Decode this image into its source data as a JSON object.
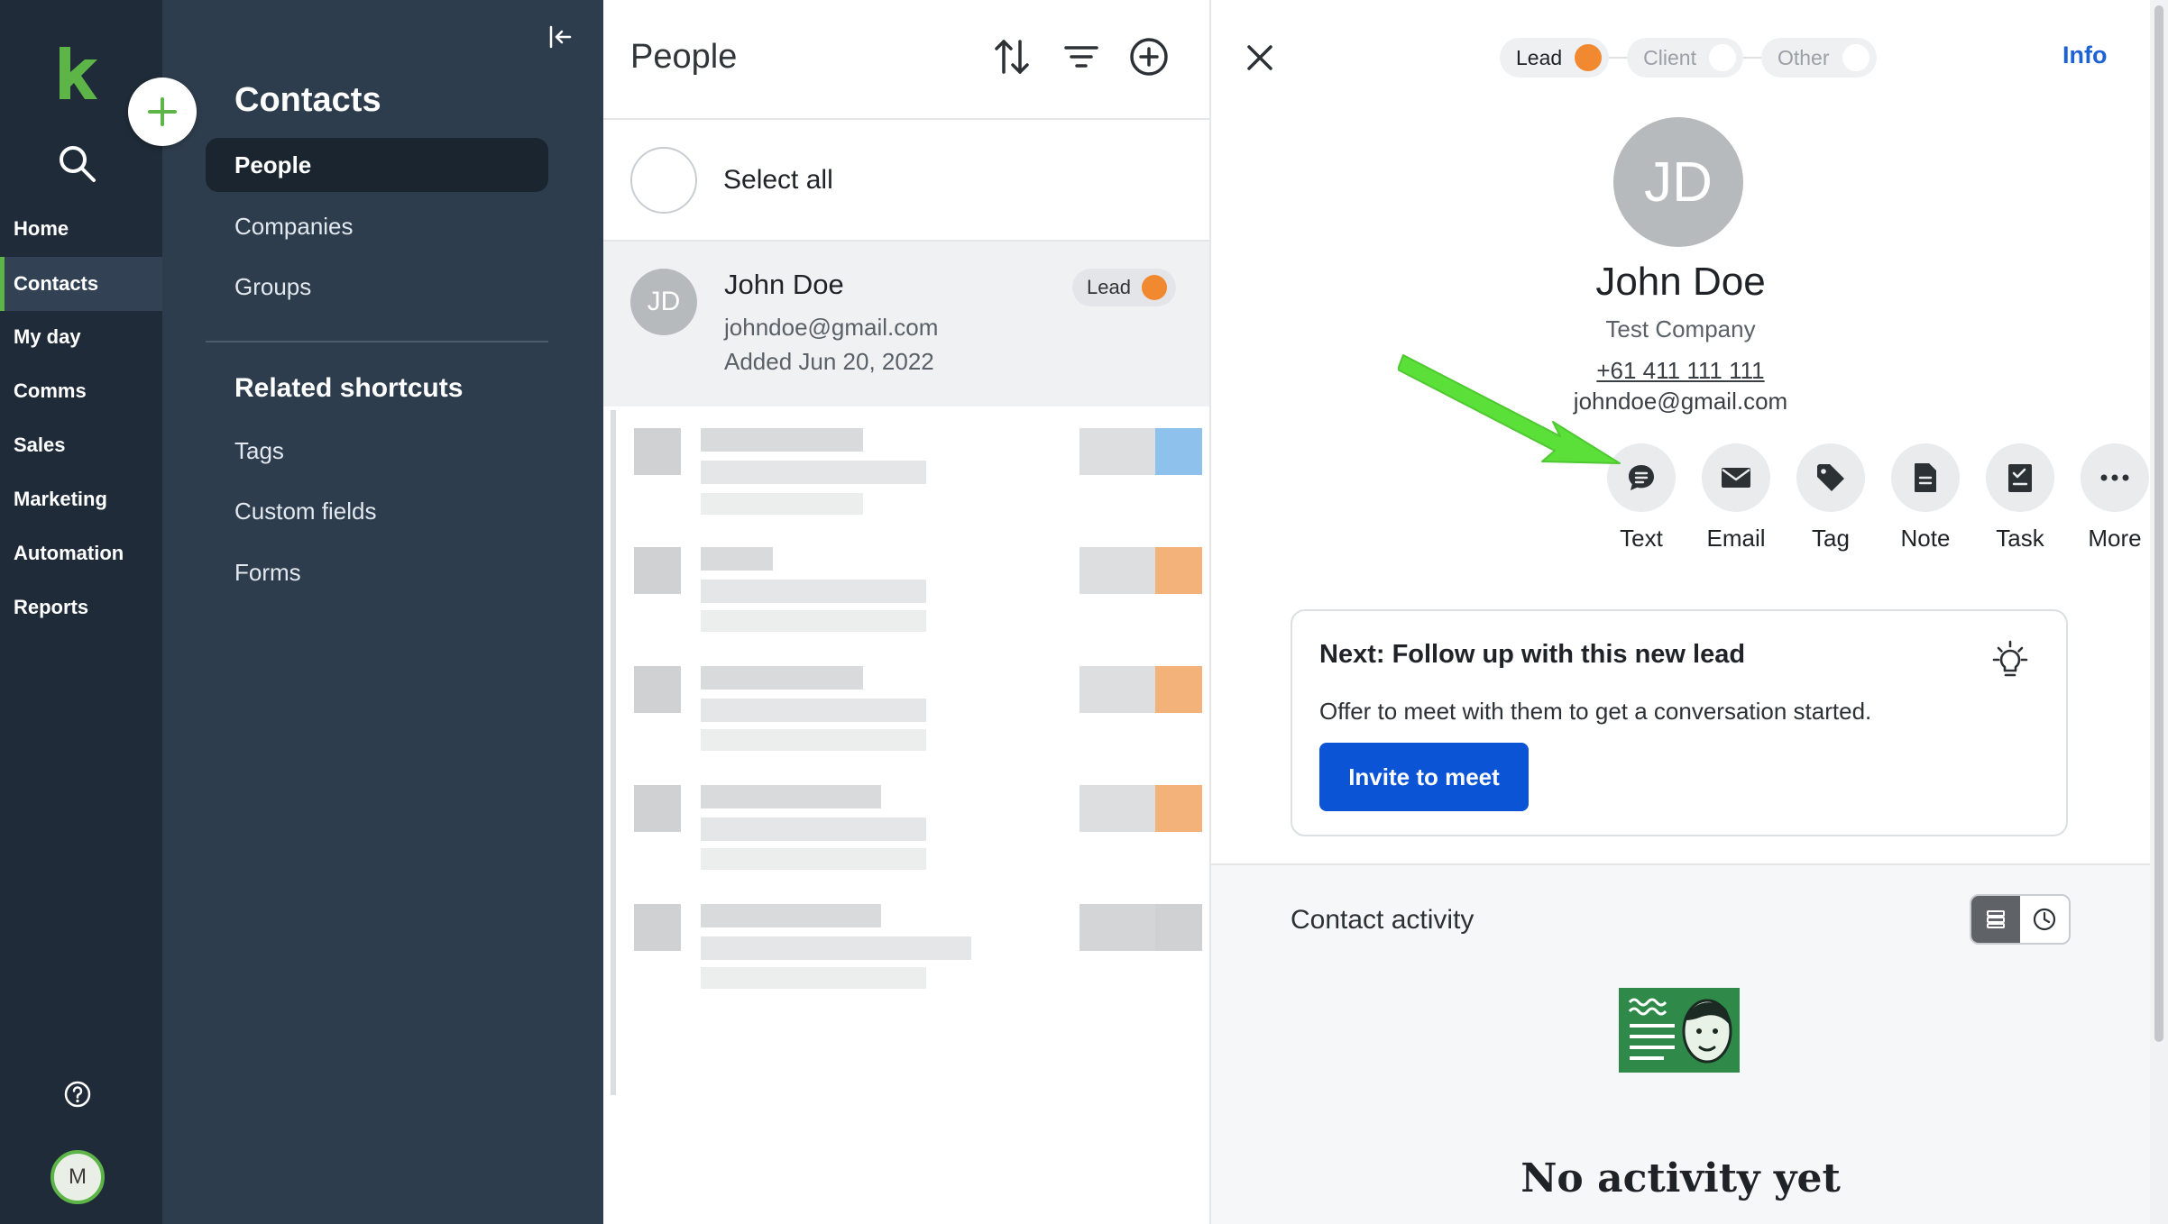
{
  "nav": {
    "items": [
      "Home",
      "Contacts",
      "My day",
      "Comms",
      "Sales",
      "Marketing",
      "Automation",
      "Reports"
    ],
    "active": "Contacts",
    "avatar_initial": "M"
  },
  "sidebar": {
    "title": "Contacts",
    "items": [
      "People",
      "Companies",
      "Groups"
    ],
    "active": "People",
    "section_title": "Related shortcuts",
    "shortcuts": [
      "Tags",
      "Custom fields",
      "Forms"
    ]
  },
  "list": {
    "heading": "People",
    "select_all": "Select all",
    "contact": {
      "initials": "JD",
      "name": "John Doe",
      "email": "johndoe@gmail.com",
      "added": "Added Jun 20, 2022",
      "stage": "Lead"
    }
  },
  "detail": {
    "stages": [
      "Lead",
      "Client",
      "Other"
    ],
    "active_stage": "Lead",
    "info_link": "Info",
    "initials": "JD",
    "name": "John Doe",
    "company": "Test Company",
    "phone": "+61 411 111 111",
    "email": "johndoe@gmail.com",
    "actions": [
      "Text",
      "Email",
      "Tag",
      "Note",
      "Task",
      "More"
    ],
    "next": {
      "title": "Next: Follow up with this new lead",
      "description": "Offer to meet with them to get a conversation started.",
      "button": "Invite to meet"
    },
    "activity": {
      "title": "Contact activity",
      "empty": "No activity yet"
    }
  },
  "colors": {
    "brand_green": "#5db447",
    "lead_orange": "#f0892f",
    "primary_blue": "#0b54d6",
    "rail_bg": "#1f2b38",
    "sidebar_bg": "#2e3d4d"
  }
}
